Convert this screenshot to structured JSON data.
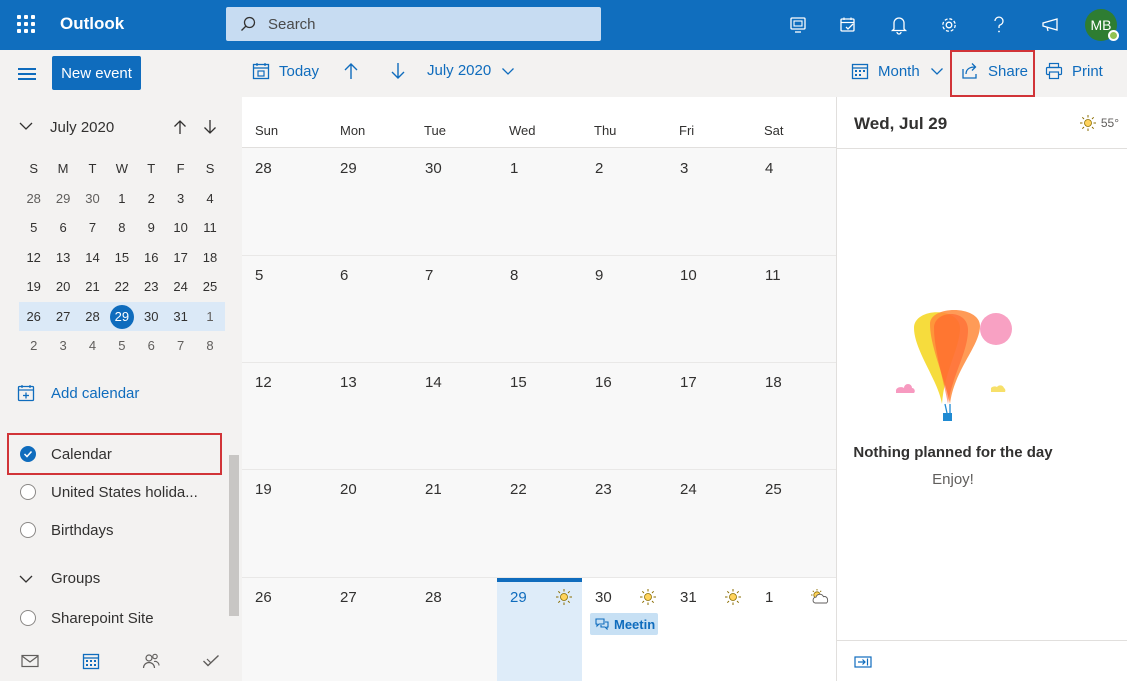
{
  "app": {
    "name": "Outlook"
  },
  "search": {
    "placeholder": "Search"
  },
  "user": {
    "initials": "MB"
  },
  "top_icons": [
    "my-day-icon",
    "todo-icon",
    "bell-icon",
    "gear-icon",
    "help-icon",
    "feedback-icon"
  ],
  "sidebar": {
    "new_event_label": "New event",
    "mini_calendar": {
      "month_label": "July 2020",
      "weekdays": [
        "S",
        "M",
        "T",
        "W",
        "T",
        "F",
        "S"
      ],
      "weeks": [
        [
          "28",
          "29",
          "30",
          "1",
          "2",
          "3",
          "4"
        ],
        [
          "5",
          "6",
          "7",
          "8",
          "9",
          "10",
          "11"
        ],
        [
          "12",
          "13",
          "14",
          "15",
          "16",
          "17",
          "18"
        ],
        [
          "19",
          "20",
          "21",
          "22",
          "23",
          "24",
          "25"
        ],
        [
          "26",
          "27",
          "28",
          "29",
          "30",
          "31",
          "1"
        ],
        [
          "2",
          "3",
          "4",
          "5",
          "6",
          "7",
          "8"
        ]
      ],
      "selected": "29"
    },
    "add_calendar_label": "Add calendar",
    "calendars": [
      {
        "label": "Calendar",
        "checked": true
      },
      {
        "label": "United States holida...",
        "checked": false
      },
      {
        "label": "Birthdays",
        "checked": false
      }
    ],
    "groups_label": "Groups",
    "groups": [
      {
        "label": "Sharepoint Site",
        "checked": false
      }
    ]
  },
  "toolbar": {
    "today_label": "Today",
    "month_label": "July 2020",
    "view_label": "Month",
    "share_label": "Share",
    "print_label": "Print"
  },
  "month_view": {
    "weekdays": [
      "Sun",
      "Mon",
      "Tue",
      "Wed",
      "Thu",
      "Fri",
      "Sat"
    ],
    "weeks": [
      [
        "28",
        "29",
        "30",
        "1",
        "2",
        "3",
        "4"
      ],
      [
        "5",
        "6",
        "7",
        "8",
        "9",
        "10",
        "11"
      ],
      [
        "12",
        "13",
        "14",
        "15",
        "16",
        "17",
        "18"
      ],
      [
        "19",
        "20",
        "21",
        "22",
        "23",
        "24",
        "25"
      ],
      [
        "26",
        "27",
        "28",
        "29",
        "30",
        "31",
        "1"
      ]
    ],
    "today": "29",
    "event": {
      "label": "Meetin"
    }
  },
  "day_pane": {
    "date_label": "Wed, Jul 29",
    "temperature": "55°",
    "empty_title": "Nothing planned for the day",
    "empty_subtitle": "Enjoy!"
  },
  "colors": {
    "brand": "#106ebe",
    "accent": "#0f6cbd",
    "highlight": "#d13438"
  }
}
